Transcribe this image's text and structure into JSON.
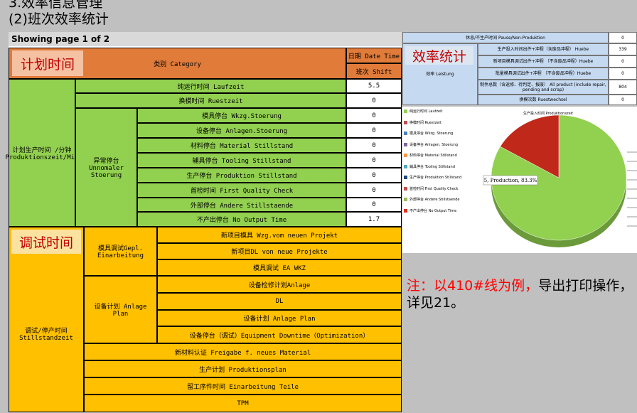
{
  "headings": {
    "title": "3.效率信息管理",
    "subtitle": "(2)班次效率统计"
  },
  "pager": "Showing page  1  of  2",
  "labels": {
    "plan_time": "计划时间",
    "debug_time": "调试时间",
    "efficiency": "效率统计"
  },
  "table": {
    "category_header": "类别 Category",
    "date_header": "日期 Date Time",
    "shift_header": "班次 Shift",
    "group_production": "计划生产时间 /分钟 Produktionszeit/Min",
    "group_unnormal": "异常停台 Unnomaler Stoerung",
    "rows": [
      {
        "label": "纯运行时间 Laufzeit",
        "value": "5.5"
      },
      {
        "label": "换模时间 Ruestzeit",
        "value": "0"
      },
      {
        "label": "模具停台 Wkzg.Stoerung",
        "value": "0"
      },
      {
        "label": "设备停台 Anlagen.Stoerung",
        "value": "0"
      },
      {
        "label": "材料停台 Material Stillstand",
        "value": "0"
      },
      {
        "label": "辅具停台 Tooling Stillstand",
        "value": "0"
      },
      {
        "label": "生产停台 Produktion Stillstand",
        "value": "0"
      },
      {
        "label": "首检时间 First Quality Check",
        "value": "0"
      },
      {
        "label": "外部停台 Andere Stillstaende",
        "value": "0"
      },
      {
        "label": "不产出停台 No Output Time",
        "value": "1.7"
      }
    ],
    "group_debug": "调试/停产时间 Stillstandzeit",
    "group_mold": "模具调试Gepl. Einarbeitung",
    "group_device": "设备计划 Anlage Plan",
    "mold_rows": [
      "新项目模具 Wzg.vom neuen Projekt",
      "新项目DL von neue Projekte",
      "模具调试 EA WKZ"
    ],
    "device_rows": [
      "设备检修计划Anlage",
      "DL",
      "设备计划 Anlage Plan",
      "设备停台（调试）Equipment Downtime（Optimization）"
    ],
    "bottom_rows": [
      "新材料认证 Freigabe f. neues Material",
      "生产计划  Produktionsplan",
      "留工序件时间 Einarbeitung Teile",
      "TPM"
    ]
  },
  "right_table": {
    "group": "效率 Leistung",
    "rows": [
      {
        "label": "休息/不生产时间 Pause/Non-Produktion",
        "value": "0"
      },
      {
        "label": "生产投入时间出件+冲程（含废品冲程） Huebe",
        "value": "339"
      },
      {
        "label": "新项目模具调试出件+冲程 （不含废品冲程）Huebe",
        "value": "0"
      },
      {
        "label": "批量模具调试出件+冲程 （不含废品冲程）Huebe",
        "value": "0"
      },
      {
        "label": "制件总数（含返修、待判定、报废） All product (include repair, pending and scrap)",
        "value": "804"
      },
      {
        "label": "换模次数 Ruestwechsel",
        "value": "0"
      }
    ]
  },
  "chart_data": {
    "type": "pie",
    "title": "生产投入时间 Produktionszeit",
    "legend": [
      {
        "name": "纯运行时间 Laufzeit",
        "color": "#92d050"
      },
      {
        "name": "换模时间 Ruestzeit",
        "color": "#c0504d"
      },
      {
        "name": "模具停台 Wkzg. Stoerung",
        "color": "#4f81bd"
      },
      {
        "name": "设备停台 Anlagen. Stoerung",
        "color": "#8064a2"
      },
      {
        "name": "材料停台 Material Stillstand",
        "color": "#f79646"
      },
      {
        "name": "辅具停台 Tooling Stillstand",
        "color": "#4bacc6"
      },
      {
        "name": "生产停台 Produktion Stillstand",
        "color": "#1f497d"
      },
      {
        "name": "首检时间 First Quality Check",
        "color": "#c0504d"
      },
      {
        "name": "外部停台 Andere Stillstaende",
        "color": "#9bbb59"
      },
      {
        "name": "不产出停台 No Output Time",
        "color": "#e0301e"
      }
    ],
    "slices": [
      {
        "name": "Production",
        "value": 83.3,
        "color": "#92d050"
      },
      {
        "name": "No Output",
        "value": 16.7,
        "color": "#c0291a"
      }
    ],
    "data_label": "5, Production, 83.3%"
  },
  "note": {
    "red": "注：以410#线为例，",
    "black": "导出打印操作，详见21。"
  }
}
